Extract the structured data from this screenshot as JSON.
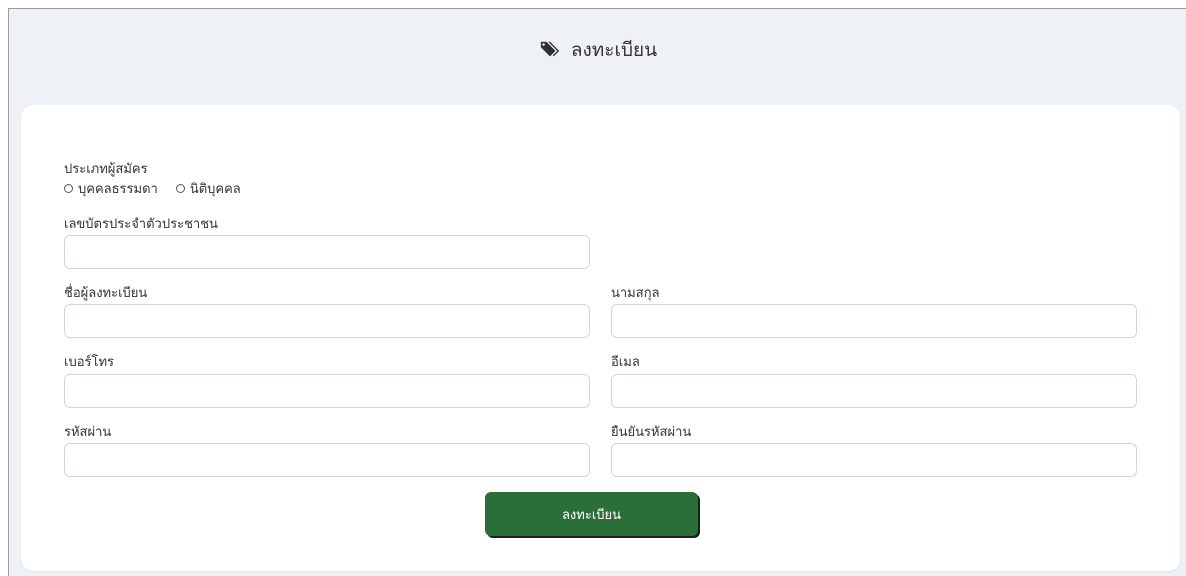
{
  "header": {
    "icon": "tag-icon",
    "title": "ลงทะเบียน"
  },
  "form": {
    "applicant_type": {
      "label": "ประเภทผู้สมัคร",
      "options": [
        "บุคคลธรรมดา",
        "นิติบุคคล"
      ],
      "selected": null
    },
    "citizen_id": {
      "label": "เลขบัตรประจำตัวประชาชน",
      "value": ""
    },
    "first_name": {
      "label": "ชื่อผู้ลงทะเบียน",
      "value": ""
    },
    "last_name": {
      "label": "นามสกุล",
      "value": ""
    },
    "phone": {
      "label": "เบอร์โทร",
      "value": ""
    },
    "email": {
      "label": "อีเมล",
      "value": ""
    },
    "password": {
      "label": "รหัสผ่าน",
      "value": ""
    },
    "confirm_password": {
      "label": "ยืนยันรหัสผ่าน",
      "value": ""
    },
    "submit_label": "ลงทะเบียน"
  },
  "colors": {
    "background": "#eef2f7",
    "card": "#ffffff",
    "button": "#2c6e3a",
    "input_border": "#cfd6de"
  }
}
